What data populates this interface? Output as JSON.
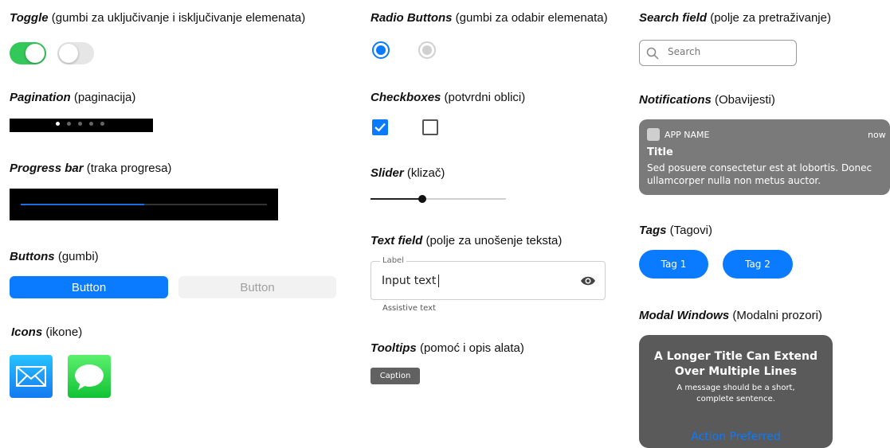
{
  "toggle": {
    "title": "Toggle",
    "subtitle": " (gumbi za uključivanje i isključivanje elemenata)",
    "on_color": "#34c759",
    "states": [
      "on",
      "off"
    ]
  },
  "pagination": {
    "title": "Pagination",
    "subtitle": " (paginacija)",
    "pages": 5,
    "current": 1
  },
  "progress": {
    "title": "Progress bar",
    "subtitle": " (traka progresa)",
    "value": 0.5,
    "color": "#1a6fe0"
  },
  "buttons": {
    "title": "Buttons",
    "subtitle": " (gumbi)",
    "primary_label": "Button",
    "disabled_label": "Button"
  },
  "icons": {
    "title": "Icons",
    "subtitle": " (ikone)",
    "items": [
      "mail-icon",
      "messages-icon"
    ]
  },
  "radio": {
    "title": "Radio Buttons",
    "subtitle": " (gumbi za odabir elemenata)",
    "states": [
      "selected",
      "disabled-selected"
    ]
  },
  "checkboxes": {
    "title": "Checkboxes",
    "subtitle": " (potvrdni oblici)",
    "states": [
      "checked",
      "unchecked"
    ]
  },
  "slider": {
    "title": "Slider",
    "subtitle": " (klizač)",
    "value": 0.38
  },
  "textfield": {
    "title": "Text field",
    "subtitle": " (polje za unošenje teksta)",
    "label": "Label",
    "value": "Input text",
    "assistive": "Assistive text",
    "trailing_icon": "eye-icon"
  },
  "tooltips": {
    "title": "Tooltips",
    "subtitle": " (pomoć i opis alata)",
    "caption": "Caption"
  },
  "search": {
    "title": "Search field",
    "subtitle": "  (polje za pretraživanje)",
    "placeholder": "Search"
  },
  "notifications": {
    "title": "Notifications",
    "subtitle": "  (Obavijesti)",
    "app_name": "APP NAME",
    "time": "now",
    "notif_title": "Title",
    "body": "Sed posuere consectetur est at lobortis. Donec ullamcorper nulla non metus auctor."
  },
  "tags": {
    "title": "Tags",
    "subtitle": "  (Tagovi)",
    "items": [
      "Tag 1",
      "Tag 2"
    ]
  },
  "modal": {
    "title": "Modal Windows",
    "subtitle": "  (Modalni prozori)",
    "modal_title": "A Longer Title Can Extend Over Multiple Lines",
    "message": "A message should be a short, complete sentence.",
    "action": "Action Preferred"
  }
}
